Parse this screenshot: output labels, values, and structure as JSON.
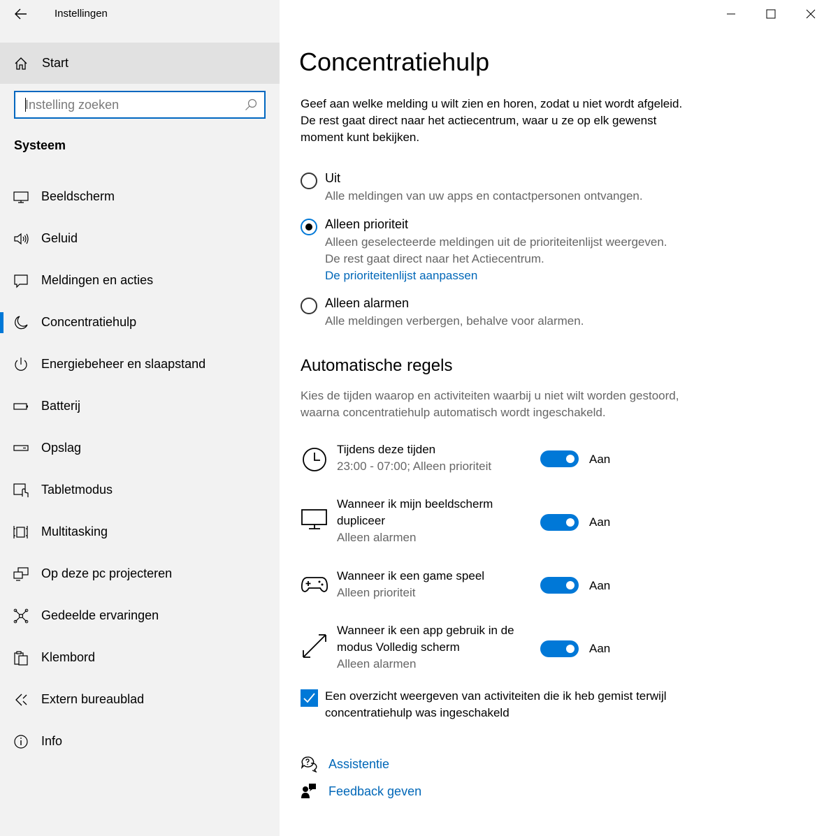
{
  "window": {
    "title": "Instellingen",
    "minimize_icon": "minimize-icon",
    "maximize_icon": "maximize-icon",
    "close_icon": "close-icon"
  },
  "sidebar": {
    "home_label": "Start",
    "search_placeholder": "Instelling zoeken",
    "section_label": "Systeem",
    "items": [
      {
        "label": "Beeldscherm",
        "icon": "monitor-icon"
      },
      {
        "label": "Geluid",
        "icon": "speaker-icon"
      },
      {
        "label": "Meldingen en acties",
        "icon": "notification-icon"
      },
      {
        "label": "Concentratiehulp",
        "icon": "moon-icon",
        "active": true
      },
      {
        "label": "Energiebeheer en slaapstand",
        "icon": "power-icon"
      },
      {
        "label": "Batterij",
        "icon": "battery-icon"
      },
      {
        "label": "Opslag",
        "icon": "storage-icon"
      },
      {
        "label": "Tabletmodus",
        "icon": "tablet-icon"
      },
      {
        "label": "Multitasking",
        "icon": "multitasking-icon"
      },
      {
        "label": "Op deze pc projecteren",
        "icon": "project-icon"
      },
      {
        "label": "Gedeelde ervaringen",
        "icon": "shared-icon"
      },
      {
        "label": "Klembord",
        "icon": "clipboard-icon"
      },
      {
        "label": "Extern bureaublad",
        "icon": "remote-desktop-icon"
      },
      {
        "label": "Info",
        "icon": "info-icon"
      }
    ]
  },
  "main": {
    "title": "Concentratiehulp",
    "intro": "Geef aan welke melding u wilt zien en horen, zodat u niet wordt afgeleid. De rest gaat direct naar het actiecentrum, waar u ze op elk gewenst moment kunt bekijken.",
    "options": [
      {
        "label": "Uit",
        "desc": "Alle meldingen van uw apps en contactpersonen ontvangen.",
        "selected": false
      },
      {
        "label": "Alleen prioriteit",
        "desc": "Alleen geselecteerde meldingen uit de prioriteitenlijst weergeven.",
        "desc2": "De rest gaat direct naar het Actiecentrum.",
        "link": "De prioriteitenlijst aanpassen",
        "selected": true
      },
      {
        "label": "Alleen alarmen",
        "desc": "Alle meldingen verbergen, behalve voor alarmen.",
        "selected": false
      }
    ],
    "rules_heading": "Automatische regels",
    "rules_desc": "Kies de tijden waarop en activiteiten waarbij u niet wilt worden gestoord, waarna concentratiehulp automatisch wordt ingeschakeld.",
    "rules": [
      {
        "title": "Tijdens deze tijden",
        "sub": "23:00 - 07:00; Alleen prioriteit",
        "state": "Aan",
        "icon": "clock-icon"
      },
      {
        "title": "Wanneer ik mijn beeldscherm dupliceer",
        "sub": "Alleen alarmen",
        "state": "Aan",
        "icon": "monitor-icon"
      },
      {
        "title": "Wanneer ik een game speel",
        "sub": "Alleen prioriteit",
        "state": "Aan",
        "icon": "gamepad-icon"
      },
      {
        "title": "Wanneer ik een app gebruik in de modus Volledig scherm",
        "sub": "Alleen alarmen",
        "state": "Aan",
        "icon": "fullscreen-icon"
      }
    ],
    "summary_checkbox": "Een overzicht weergeven van activiteiten die ik heb gemist terwijl concentratiehulp was ingeschakeld",
    "help_link": "Assistentie",
    "feedback_link": "Feedback geven"
  },
  "colors": {
    "accent": "#0078d7",
    "link": "#0067b8",
    "sidebar_bg": "#f2f2f2",
    "home_bg": "#e1e1e1"
  }
}
